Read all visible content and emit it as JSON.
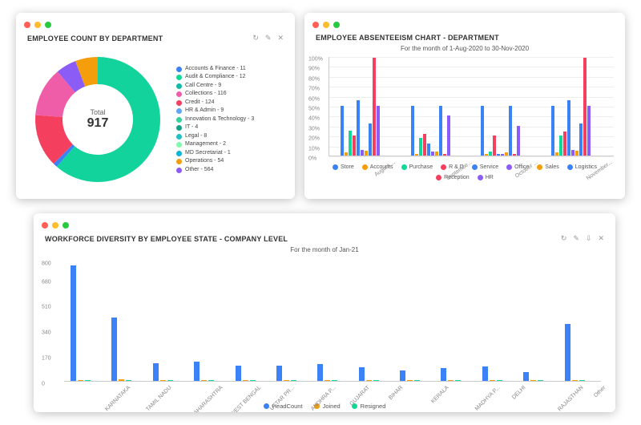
{
  "chart_data": [
    {
      "id": "employee_count",
      "type": "pie",
      "title": "EMPLOYEE COUNT BY DEPARTMENT",
      "center_label": "Total",
      "center_value": "917",
      "series": [
        {
          "name": "Accounts & Finance",
          "value": 11,
          "color": "#3b82f6"
        },
        {
          "name": "Audit & Compliance",
          "value": 12,
          "color": "#10d997"
        },
        {
          "name": "Call Centre",
          "value": 9,
          "color": "#14b8a6"
        },
        {
          "name": "Collections",
          "value": 116,
          "color": "#ef5da8"
        },
        {
          "name": "Credit",
          "value": 124,
          "color": "#f43f5e"
        },
        {
          "name": "HR & Admin",
          "value": 9,
          "color": "#60a5fa"
        },
        {
          "name": "Innovation & Technology",
          "value": 3,
          "color": "#34d399"
        },
        {
          "name": "IT",
          "value": 4,
          "color": "#16a085"
        },
        {
          "name": "Legal",
          "value": 8,
          "color": "#22c1c3"
        },
        {
          "name": "Management",
          "value": 2,
          "color": "#84fab0"
        },
        {
          "name": "MD Secretariat",
          "value": 1,
          "color": "#06b6d4"
        },
        {
          "name": "Operations",
          "value": 54,
          "color": "#f59e0b"
        },
        {
          "name": "Other",
          "value": 564,
          "color": "#8b5cf6"
        }
      ],
      "donut_colors": [
        {
          "c": "#12d39b",
          "a": 221
        },
        {
          "c": "#3b82f6",
          "a": 4
        },
        {
          "c": "#f43f5e",
          "a": 49
        },
        {
          "c": "#ef5da8",
          "a": 46
        },
        {
          "c": "#8b5cf6",
          "a": 19
        },
        {
          "c": "#f59e0b",
          "a": 21
        }
      ]
    },
    {
      "id": "absenteeism",
      "type": "bar",
      "title": "EMPLOYEE ABSENTEEISM CHART - DEPARTMENT",
      "subtitle": "For the month of 1-Aug-2020 to 30-Nov-2020",
      "ylabel": "%",
      "ylim": [
        0,
        100
      ],
      "yticks": [
        0,
        10,
        20,
        30,
        40,
        50,
        60,
        70,
        80,
        90,
        100
      ],
      "categories": [
        "August ...",
        "Septembe...",
        "October ...",
        "November..."
      ],
      "series": [
        {
          "name": "Store",
          "color": "#3b82f6",
          "values": [
            50,
            50,
            50,
            50
          ]
        },
        {
          "name": "Accounts",
          "color": "#f59e0b",
          "values": [
            3,
            2,
            2,
            3
          ]
        },
        {
          "name": "Purchase",
          "color": "#10d997",
          "values": [
            25,
            18,
            4,
            20
          ]
        },
        {
          "name": "R & D",
          "color": "#f43f5e",
          "values": [
            20,
            22,
            20,
            24
          ]
        },
        {
          "name": "Service",
          "color": "#3b82f6",
          "values": [
            56,
            12,
            2,
            56
          ]
        },
        {
          "name": "Office",
          "color": "#8b5cf6",
          "values": [
            6,
            4,
            2,
            6
          ]
        },
        {
          "name": "Sales",
          "color": "#f59e0b",
          "values": [
            5,
            4,
            3,
            5
          ]
        },
        {
          "name": "Logistics",
          "color": "#3b82f6",
          "values": [
            32,
            50,
            50,
            32
          ]
        },
        {
          "name": "Reception",
          "color": "#f43f5e",
          "values": [
            98,
            2,
            2,
            98
          ]
        },
        {
          "name": "HR",
          "color": "#8b5cf6",
          "values": [
            50,
            40,
            30,
            50
          ]
        }
      ]
    },
    {
      "id": "diversity",
      "type": "bar",
      "title": "WORKFORCE DIVERSITY BY EMPLOYEE STATE - COMPANY LEVEL",
      "subtitle": "For the month of Jan-21",
      "ylim": [
        0,
        800
      ],
      "yticks": [
        0,
        170,
        340,
        510,
        680,
        800
      ],
      "categories": [
        "KARNATAKA",
        "TAMIL NADU",
        "MAHARASHTRA",
        "WEST BENGAL",
        "UTTAR PR...",
        "ANDHRA P...",
        "GUJARAT",
        "BIHAR",
        "KERALA",
        "MADHYA P...",
        "DELHI",
        "RAJASTHAN",
        "Other"
      ],
      "series": [
        {
          "name": "HeadCount",
          "color": "#3b82f6",
          "values": [
            770,
            420,
            120,
            130,
            100,
            100,
            110,
            90,
            70,
            85,
            95,
            60,
            380
          ]
        },
        {
          "name": "Joined",
          "color": "#f59e0b",
          "values": [
            8,
            10,
            5,
            3,
            2,
            2,
            2,
            1,
            1,
            1,
            1,
            1,
            6
          ]
        },
        {
          "name": "Resigned",
          "color": "#10d997",
          "values": [
            6,
            8,
            4,
            2,
            2,
            2,
            1,
            1,
            1,
            1,
            1,
            1,
            5
          ]
        }
      ],
      "toolbar_icons": [
        "refresh",
        "edit",
        "download",
        "close"
      ]
    }
  ],
  "card1_tools": {
    "refresh": "↻",
    "edit": "✎",
    "close": "✕"
  },
  "card3_tools": {
    "refresh": "↻",
    "edit": "✎",
    "download": "⇩",
    "close": "✕"
  }
}
